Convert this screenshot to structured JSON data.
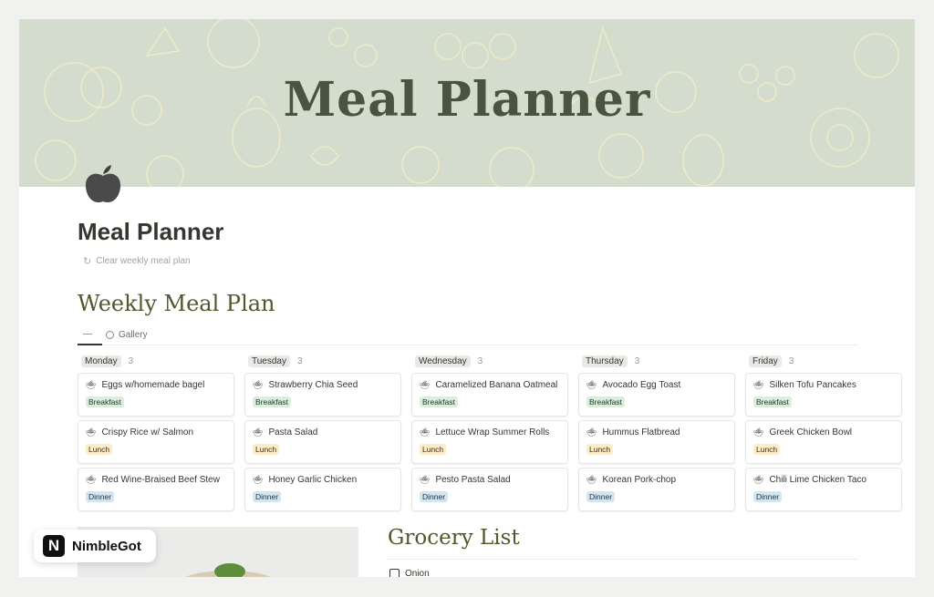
{
  "banner": {
    "title": "Meal Planner"
  },
  "page": {
    "title": "Meal Planner",
    "clear_button": "Clear weekly meal plan",
    "icon": "apple-icon"
  },
  "weekly": {
    "title": "Weekly Meal Plan",
    "views": [
      {
        "label": ""
      },
      {
        "label": "Gallery"
      }
    ],
    "columns": [
      {
        "day": "Monday",
        "count": "3",
        "cards": [
          {
            "name": "Eggs w/homemade bagel",
            "tag": "Breakfast"
          },
          {
            "name": "Crispy Rice w/ Salmon",
            "tag": "Lunch"
          },
          {
            "name": "Red Wine-Braised Beef Stew",
            "tag": "Dinner"
          }
        ]
      },
      {
        "day": "Tuesday",
        "count": "3",
        "cards": [
          {
            "name": "Strawberry Chia Seed",
            "tag": "Breakfast"
          },
          {
            "name": "Pasta Salad",
            "tag": "Lunch"
          },
          {
            "name": "Honey Garlic Chicken",
            "tag": "Dinner"
          }
        ]
      },
      {
        "day": "Wednesday",
        "count": "3",
        "cards": [
          {
            "name": "Caramelized Banana Oatmeal",
            "tag": "Breakfast"
          },
          {
            "name": "Lettuce Wrap Summer Rolls",
            "tag": "Lunch"
          },
          {
            "name": "Pesto Pasta Salad",
            "tag": "Dinner"
          }
        ]
      },
      {
        "day": "Thursday",
        "count": "3",
        "cards": [
          {
            "name": "Avocado Egg Toast",
            "tag": "Breakfast"
          },
          {
            "name": "Hummus Flatbread",
            "tag": "Lunch"
          },
          {
            "name": "Korean Pork-chop",
            "tag": "Dinner"
          }
        ]
      },
      {
        "day": "Friday",
        "count": "3",
        "cards": [
          {
            "name": "Silken Tofu Pancakes",
            "tag": "Breakfast"
          },
          {
            "name": "Greek Chicken Bowl",
            "tag": "Lunch"
          },
          {
            "name": "Chili Lime Chicken Taco",
            "tag": "Dinner"
          }
        ]
      }
    ]
  },
  "grocery": {
    "title": "Grocery List",
    "items": [
      {
        "label": "Onion",
        "checked": false
      }
    ]
  },
  "watermark": {
    "brand": "NimbleGot",
    "logo_letter": "N"
  },
  "colors": {
    "banner_bg": "#d3dccd",
    "heading_green": "#4c5a2a",
    "breakfast": "#dbeddb",
    "lunch": "#fdecc8",
    "dinner": "#d3e5ef"
  }
}
